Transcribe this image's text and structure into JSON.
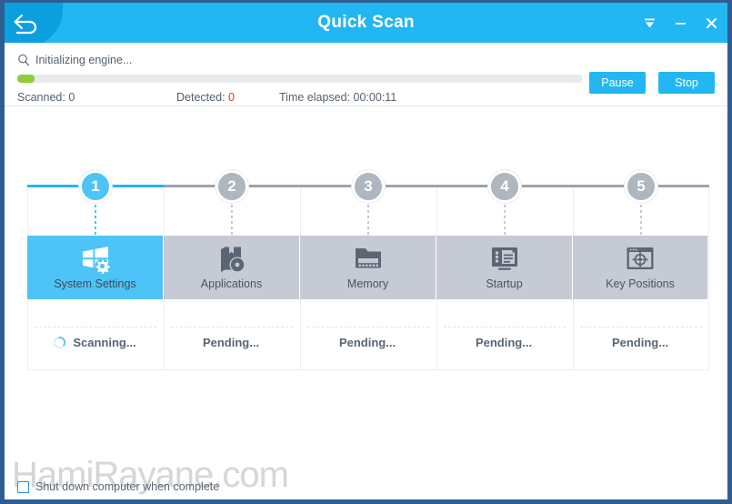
{
  "window": {
    "title": "Quick Scan",
    "back_icon": "back-arrow-icon",
    "controls": [
      {
        "name": "minimize-to-tray-icon",
        "label": ""
      },
      {
        "name": "minimize-icon",
        "label": ""
      },
      {
        "name": "close-icon",
        "label": ""
      }
    ],
    "colors": {
      "titlebar": "#22b7f2",
      "back_button": "#0c9fe0",
      "border": "#2e5d92",
      "accent": "#4ec3f7",
      "pending": "#c6cad4",
      "progress": "#8dce36",
      "detected": "#e8332a"
    }
  },
  "scan": {
    "status_icon": "magnifier-icon",
    "status_text": "Initializing engine...",
    "progress_percent": 3,
    "stats": {
      "scanned_label": "Scanned:",
      "scanned_value": "0",
      "detected_label": "Detected:",
      "detected_value": "0",
      "elapsed_label": "Time elapsed:",
      "elapsed_value": "00:00:11"
    },
    "buttons": {
      "pause": "Pause",
      "stop": "Stop"
    }
  },
  "steps": [
    {
      "number": "1",
      "label": "System Settings",
      "icon": "windows-settings-icon",
      "status": "Scanning...",
      "state": "active"
    },
    {
      "number": "2",
      "label": "Applications",
      "icon": "applications-disc-icon",
      "status": "Pending...",
      "state": "pending"
    },
    {
      "number": "3",
      "label": "Memory",
      "icon": "memory-module-icon",
      "status": "Pending...",
      "state": "pending"
    },
    {
      "number": "4",
      "label": "Startup",
      "icon": "startup-monitor-icon",
      "status": "Pending...",
      "state": "pending"
    },
    {
      "number": "5",
      "label": "Key Positions",
      "icon": "key-positions-target-icon",
      "status": "Pending...",
      "state": "pending"
    }
  ],
  "footer": {
    "shutdown_label": "Shut down computer when complete",
    "shutdown_checked": false
  },
  "watermark": "HamiRayane.com"
}
